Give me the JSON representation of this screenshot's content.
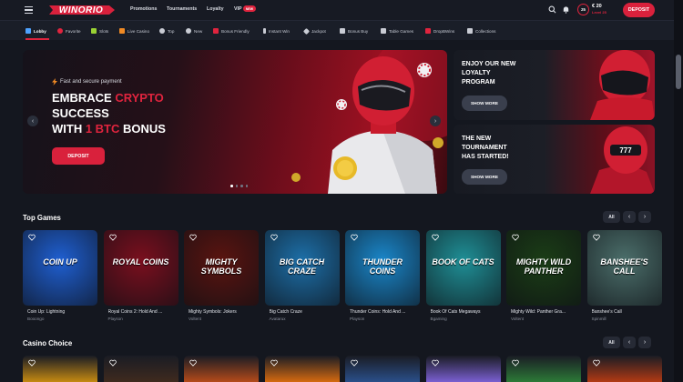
{
  "header": {
    "logo": "WINORIO",
    "nav": [
      "Promotions",
      "Tournaments",
      "Loyalty",
      "VIP"
    ],
    "vip_badge": "NEW",
    "level_number": "25",
    "balance": "€ 20",
    "level_label": "Level 25",
    "deposit_label": "DEPOSIT"
  },
  "categories": [
    {
      "label": "Lobby",
      "icon": "home-icon",
      "color": "#4fa3ff"
    },
    {
      "label": "Favorite",
      "icon": "heart-icon",
      "color": "#e0243e"
    },
    {
      "label": "Slots",
      "icon": "slots-icon",
      "color": "#9ad234"
    },
    {
      "label": "Live Casino",
      "icon": "live-icon",
      "color": "#f08a24"
    },
    {
      "label": "Top",
      "icon": "top-icon",
      "color": "#c9ccd4"
    },
    {
      "label": "New",
      "icon": "new-icon",
      "color": "#c9ccd4"
    },
    {
      "label": "Bonus Friendly",
      "icon": "bonus-icon",
      "color": "#e0243e"
    },
    {
      "label": "Instant Win",
      "icon": "bolt-icon",
      "color": "#c9ccd4"
    },
    {
      "label": "Jackpot",
      "icon": "diamond-icon",
      "color": "#c9ccd4"
    },
    {
      "label": "Bonus Buy",
      "icon": "bonus-buy-icon",
      "color": "#c9ccd4"
    },
    {
      "label": "Table Games",
      "icon": "cards-icon",
      "color": "#c9ccd4"
    },
    {
      "label": "DropBWins",
      "icon": "drops-icon",
      "color": "#e0243e"
    },
    {
      "label": "Collections",
      "icon": "collections-icon",
      "color": "#c9ccd4"
    }
  ],
  "hero": {
    "tag": "Fast and secure payment",
    "line1_a": "EMBRACE ",
    "line1_b": "CRYPTO",
    "line2": "SUCCESS",
    "line3_a": "WITH ",
    "line3_b": "1 BTC",
    "line3_c": " BONUS",
    "button": "DEPOSIT"
  },
  "promos": [
    {
      "title_1": "ENJOY OUR NEW",
      "title_2": "LOYALTY",
      "title_3": "PROGRAM",
      "button": "SHOW MORE"
    },
    {
      "title_1": "THE NEW",
      "title_2": "TOURNAMENT",
      "title_3": "HAS STARTED!",
      "button": "SHOW MORE"
    }
  ],
  "sections": {
    "top_games": "Top Games",
    "casino_choice": "Casino Choice",
    "all_label": "All"
  },
  "games": [
    {
      "name": "Coin Up: Lightning",
      "provider": "Booongo",
      "art": "COIN UP",
      "bg": "#1f5fd1"
    },
    {
      "name": "Royal Coins 2: Hold And ...",
      "provider": "Playson",
      "art": "ROYAL COINS",
      "bg": "#7a0f1e"
    },
    {
      "name": "Mighty Symbols: Jokers",
      "provider": "Voltent",
      "art": "MIGHTY SYMBOLS",
      "bg": "#5a1410"
    },
    {
      "name": "Big Catch Craze",
      "provider": "Avatarux",
      "art": "BIG CATCH CRAZE",
      "bg": "#1d6fa8"
    },
    {
      "name": "Thunder Coins: Hold And ...",
      "provider": "Playson",
      "art": "THUNDER COINS",
      "bg": "#1a86c9"
    },
    {
      "name": "Book Of Cats Megaways",
      "provider": "Bgaming",
      "art": "BOOK OF CATS",
      "bg": "#1f8f96"
    },
    {
      "name": "Mighty Wild: Panther Gra...",
      "provider": "Voltent",
      "art": "MIGHTY WILD PANTHER",
      "bg": "#1b3d16"
    },
    {
      "name": "Banshee's Call",
      "provider": "Spinmill",
      "art": "BANSHEE'S CALL",
      "bg": "#4b6e6a"
    }
  ],
  "casino_choice_tiles": [
    "#c58a12",
    "#3f2a1e",
    "#b44a1a",
    "#d56a10",
    "#2a4f8a",
    "#7a5fd1",
    "#2c7a37",
    "#b23a14"
  ]
}
